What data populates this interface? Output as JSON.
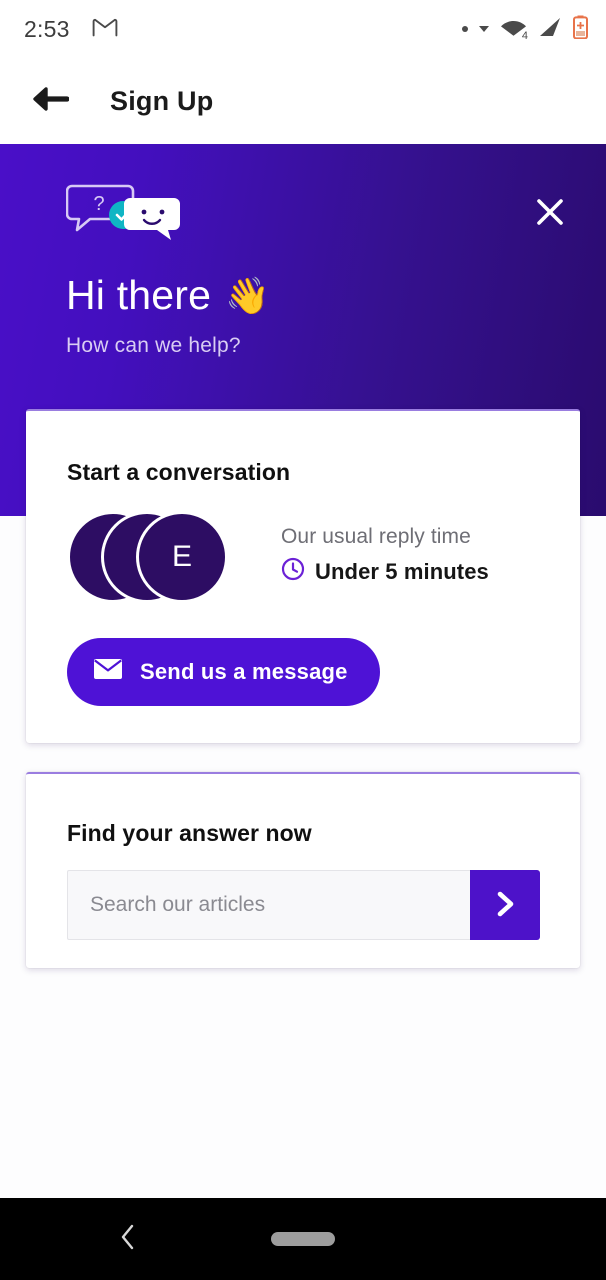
{
  "status_bar": {
    "time": "2:53",
    "gmail_icon": "gmail-icon",
    "dot_icon": "dot-indicator-icon",
    "caret_icon": "caret-down-icon",
    "wifi_icon": "wifi-icon",
    "wifi_label": "4",
    "cell_icon": "cell-signal-icon",
    "battery_icon": "battery-low-icon"
  },
  "appbar": {
    "back_icon": "back-arrow-icon",
    "title": "Sign Up"
  },
  "hero": {
    "logo_icon": "chat-bubbles-logo-icon",
    "close_icon": "close-icon",
    "title": "Hi there",
    "title_emoji": "👋",
    "subtitle": "How can we help?",
    "gradient_start": "#4a0fc8",
    "gradient_end": "#2a0b6e"
  },
  "conversation_card": {
    "title": "Start a conversation",
    "avatars": [
      "",
      "",
      "E"
    ],
    "reply_label": "Our usual reply time",
    "reply_icon": "clock-icon",
    "reply_value": "Under 5 minutes",
    "send_icon": "envelope-icon",
    "send_label": "Send us a message",
    "button_color": "#4e12d6"
  },
  "search_card": {
    "title": "Find your answer now",
    "search_value": "",
    "search_placeholder": "Search our articles",
    "submit_icon": "chevron-right-icon",
    "submit_color": "#4d12c9"
  },
  "nav_bar": {
    "back_icon": "nav-back-icon",
    "home_icon": "nav-home-pill-icon"
  }
}
